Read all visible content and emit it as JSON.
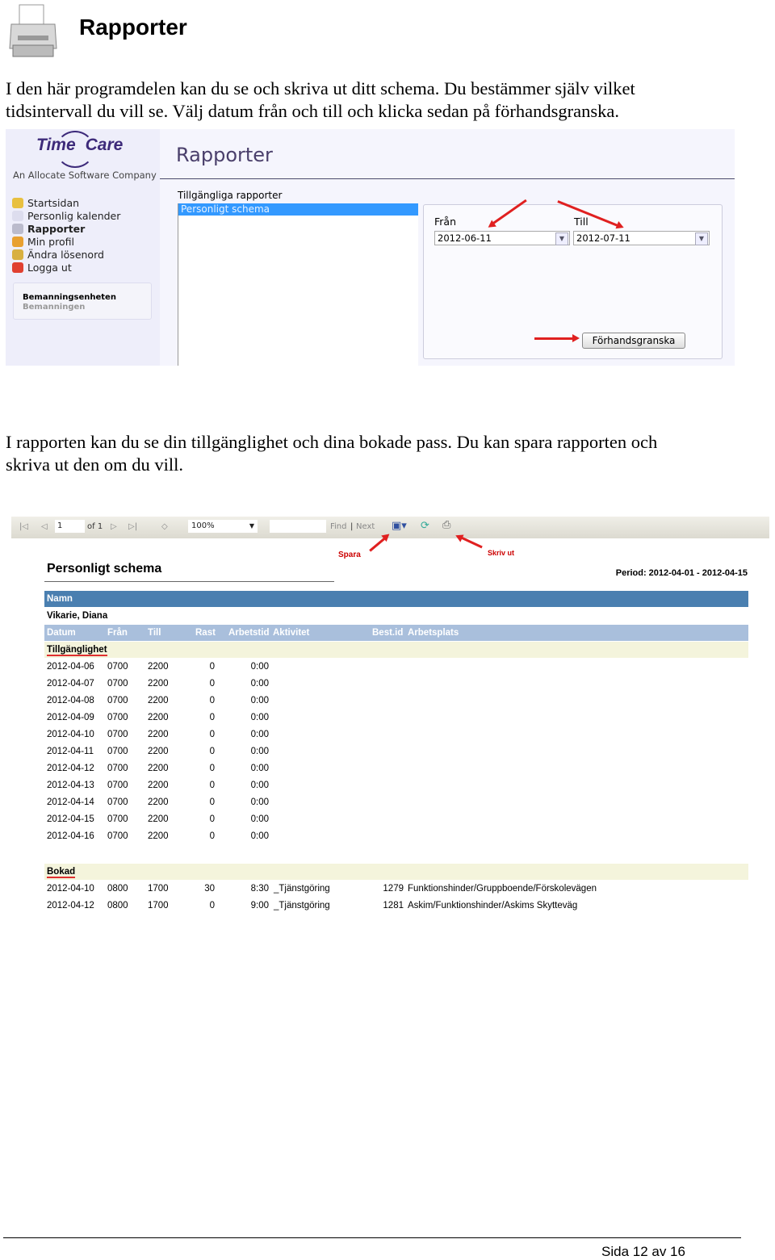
{
  "page": {
    "heading": "Rapporter",
    "intro_lines": [
      "I den här programdelen kan du se och skriva ut ditt schema. Du bestämmer själv vilket",
      "tidsintervall du vill se. Välj datum från och till och klicka sedan på förhandsgranska."
    ],
    "body_lines": [
      "I rapporten kan du se din tillgänglighet och dina bokade pass. Du kan spara rapporten och",
      "skriva ut den om du vill."
    ],
    "footer": "Sida 12 av 16"
  },
  "app": {
    "logo_time": "Time",
    "logo_care": "Care",
    "tagline": "An Allocate Software Company",
    "title": "Rapporter",
    "nav": [
      {
        "label": "Startsidan",
        "icon": "clock-icon",
        "color": "#e8c040"
      },
      {
        "label": "Personlig kalender",
        "icon": "calendar-icon",
        "color": "#dde"
      },
      {
        "label": "Rapporter",
        "icon": "printer-icon",
        "color": "#bbc",
        "active": true
      },
      {
        "label": "Min profil",
        "icon": "user-icon",
        "color": "#e8a030"
      },
      {
        "label": "Ändra lösenord",
        "icon": "lock-icon",
        "color": "#d8b040"
      },
      {
        "label": "Logga ut",
        "icon": "power-icon",
        "color": "#e04030"
      }
    ],
    "unit_name": "Bemanningsenheten",
    "unit_sub": "Bemanningen",
    "reports_label": "Tillgängliga rapporter",
    "reports": [
      "Personligt schema"
    ],
    "from_label": "Från",
    "from_value": "2012-06-11",
    "to_label": "Till",
    "to_value": "2012-07-11",
    "preview_button": "Förhandsgranska"
  },
  "viewer": {
    "page": "1",
    "of": "of 1",
    "zoom": "100%",
    "find": "Find",
    "next": "Next",
    "separator": "|",
    "save_annotation": "Spara",
    "print_annotation": "Skriv ut"
  },
  "report": {
    "title": "Personligt schema",
    "period": "Period: 2012-04-01 - 2012-04-15",
    "name_header": "Namn",
    "name": "Vikarie, Diana",
    "columns": [
      "Datum",
      "Från",
      "Till",
      "Rast",
      "Arbetstid",
      "Aktivitet",
      "Best.id",
      "Arbetsplats"
    ],
    "availability_label": "Tillgänglighet",
    "availability": [
      [
        "2012-04-06",
        "0700",
        "2200",
        "0",
        "0:00"
      ],
      [
        "2012-04-07",
        "0700",
        "2200",
        "0",
        "0:00"
      ],
      [
        "2012-04-08",
        "0700",
        "2200",
        "0",
        "0:00"
      ],
      [
        "2012-04-09",
        "0700",
        "2200",
        "0",
        "0:00"
      ],
      [
        "2012-04-10",
        "0700",
        "2200",
        "0",
        "0:00"
      ],
      [
        "2012-04-11",
        "0700",
        "2200",
        "0",
        "0:00"
      ],
      [
        "2012-04-12",
        "0700",
        "2200",
        "0",
        "0:00"
      ],
      [
        "2012-04-13",
        "0700",
        "2200",
        "0",
        "0:00"
      ],
      [
        "2012-04-14",
        "0700",
        "2200",
        "0",
        "0:00"
      ],
      [
        "2012-04-15",
        "0700",
        "2200",
        "0",
        "0:00"
      ],
      [
        "2012-04-16",
        "0700",
        "2200",
        "0",
        "0:00"
      ]
    ],
    "booked_label": "Bokad",
    "booked": [
      [
        "2012-04-10",
        "0800",
        "1700",
        "30",
        "8:30",
        "_Tjänstgöring",
        "1279",
        "Funktionshinder/Gruppboende/Förskolevägen"
      ],
      [
        "2012-04-12",
        "0800",
        "1700",
        "0",
        "9:00",
        "_Tjänstgöring",
        "1281",
        "Askim/Funktionshinder/Askims Skytteväg"
      ]
    ]
  }
}
